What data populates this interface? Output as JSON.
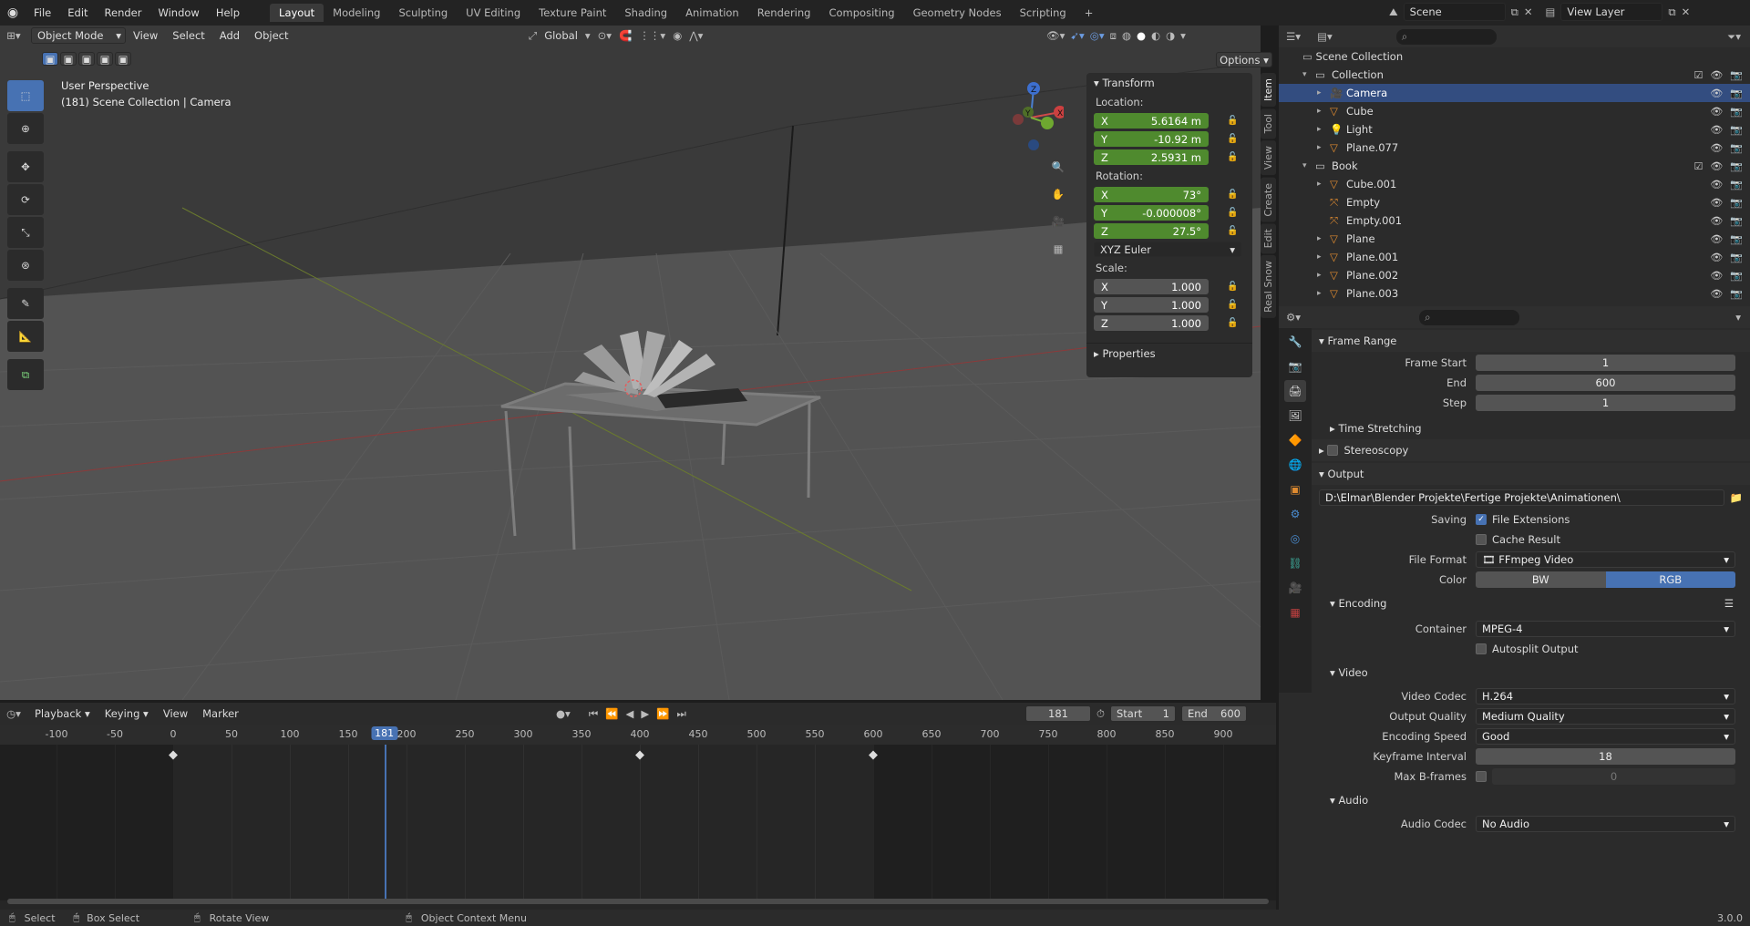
{
  "topbar": {
    "menus": [
      "File",
      "Edit",
      "Render",
      "Window",
      "Help"
    ],
    "workspaces": [
      "Layout",
      "Modeling",
      "Sculpting",
      "UV Editing",
      "Texture Paint",
      "Shading",
      "Animation",
      "Rendering",
      "Compositing",
      "Geometry Nodes",
      "Scripting"
    ],
    "active_workspace": "Layout",
    "scene": "Scene",
    "view_layer": "View Layer"
  },
  "viewport": {
    "mode": "Object Mode",
    "menus": [
      "View",
      "Select",
      "Add",
      "Object"
    ],
    "orientation": "Global",
    "options_label": "Options",
    "overlay_line1": "User Perspective",
    "overlay_line2": "(181) Scene Collection | Camera",
    "gizmo": {
      "x": "X",
      "y": "Y",
      "z": "Z"
    }
  },
  "npanel": {
    "title": "Transform",
    "location_label": "Location:",
    "location": [
      {
        "axis": "X",
        "value": "5.6164 m"
      },
      {
        "axis": "Y",
        "value": "-10.92 m"
      },
      {
        "axis": "Z",
        "value": "2.5931 m"
      }
    ],
    "rotation_label": "Rotation:",
    "rotation": [
      {
        "axis": "X",
        "value": "73°"
      },
      {
        "axis": "Y",
        "value": "-0.000008°"
      },
      {
        "axis": "Z",
        "value": "27.5°"
      }
    ],
    "rotation_mode": "XYZ Euler",
    "scale_label": "Scale:",
    "scale": [
      {
        "axis": "X",
        "value": "1.000"
      },
      {
        "axis": "Y",
        "value": "1.000"
      },
      {
        "axis": "Z",
        "value": "1.000"
      }
    ],
    "properties": "Properties",
    "tabs": [
      "Item",
      "Tool",
      "View",
      "Create",
      "Edit",
      "Real Snow"
    ]
  },
  "timeline": {
    "menus": [
      "Playback",
      "Keying",
      "View",
      "Marker"
    ],
    "current_frame": "181",
    "start_label": "Start",
    "start": "1",
    "end_label": "End",
    "end": "600",
    "ticks": [
      "-100",
      "-50",
      "0",
      "50",
      "100",
      "150",
      "200",
      "250",
      "300",
      "350",
      "400",
      "450",
      "500",
      "550",
      "600",
      "650",
      "700",
      "750",
      "800",
      "850",
      "900"
    ],
    "playhead": "181"
  },
  "statusbar": {
    "select": "Select",
    "box_select": "Box Select",
    "rotate": "Rotate View",
    "context": "Object Context Menu",
    "version": "3.0.0"
  },
  "outliner": {
    "root": "Scene Collection",
    "rows": [
      {
        "name": "Collection",
        "level": 1,
        "type": "collection"
      },
      {
        "name": "Camera",
        "level": 2,
        "type": "camera",
        "selected": true
      },
      {
        "name": "Cube",
        "level": 2,
        "type": "mesh"
      },
      {
        "name": "Light",
        "level": 2,
        "type": "light"
      },
      {
        "name": "Plane.077",
        "level": 2,
        "type": "mesh"
      },
      {
        "name": "Book",
        "level": 1,
        "type": "collection"
      },
      {
        "name": "Cube.001",
        "level": 2,
        "type": "mesh"
      },
      {
        "name": "Empty",
        "level": 2,
        "type": "empty"
      },
      {
        "name": "Empty.001",
        "level": 2,
        "type": "empty"
      },
      {
        "name": "Plane",
        "level": 2,
        "type": "mesh"
      },
      {
        "name": "Plane.001",
        "level": 2,
        "type": "mesh"
      },
      {
        "name": "Plane.002",
        "level": 2,
        "type": "mesh"
      },
      {
        "name": "Plane.003",
        "level": 2,
        "type": "mesh"
      }
    ]
  },
  "props": {
    "frame_range": {
      "title": "Frame Range",
      "start_label": "Frame Start",
      "start": "1",
      "end_label": "End",
      "end": "600",
      "step_label": "Step",
      "step": "1"
    },
    "time_stretching": "Time Stretching",
    "stereoscopy": "Stereoscopy",
    "output": {
      "title": "Output",
      "path": "D:\\Elmar\\Blender Projekte\\Fertige Projekte\\Animationen\\",
      "saving_label": "Saving",
      "file_ext": "File Extensions",
      "cache": "Cache Result",
      "format_label": "File Format",
      "format": "FFmpeg Video",
      "color_label": "Color",
      "bw": "BW",
      "rgb": "RGB"
    },
    "encoding": {
      "title": "Encoding",
      "container_label": "Container",
      "container": "MPEG-4",
      "autosplit": "Autosplit Output"
    },
    "video": {
      "title": "Video",
      "codec_label": "Video Codec",
      "codec": "H.264",
      "quality_label": "Output Quality",
      "quality": "Medium Quality",
      "speed_label": "Encoding Speed",
      "speed": "Good",
      "kf_label": "Keyframe Interval",
      "kf": "18",
      "bframes_label": "Max B-frames",
      "bframes": "0"
    },
    "audio": {
      "title": "Audio",
      "codec_label": "Audio Codec",
      "codec": "No Audio"
    }
  }
}
